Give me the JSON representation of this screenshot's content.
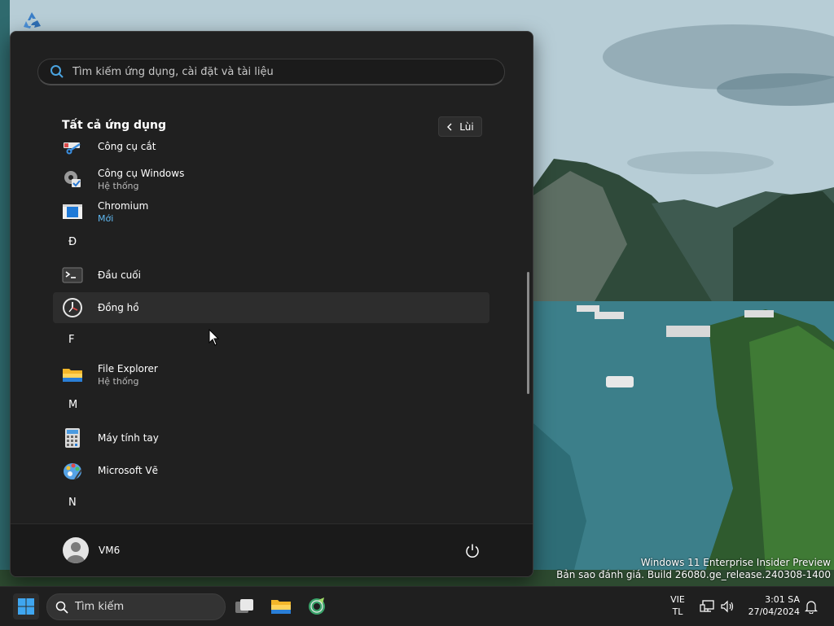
{
  "desktop": {
    "recycle_bin_icon": "recycle-bin-icon",
    "watermark_line1": "Windows 11 Enterprise Insider Preview",
    "watermark_line2": "Bản sao đánh giá. Build 26080.ge_release.240308-1400"
  },
  "start_menu": {
    "search_placeholder": "Tìm kiếm ứng dụng, cài đặt và tài liệu",
    "section_title": "Tất cả ứng dụng",
    "back_label": "Lùi",
    "apps": [
      {
        "name": "Công cụ cắt",
        "sub": "",
        "icon": "snipping-tool-icon"
      },
      {
        "name": "Công cụ Windows",
        "sub": "Hệ thống",
        "icon": "windows-tools-icon"
      },
      {
        "name": "Chromium",
        "sub": "Mới",
        "icon": "chromium-icon"
      },
      {
        "letter": "Đ"
      },
      {
        "name": "Đầu cuối",
        "sub": "",
        "icon": "terminal-icon"
      },
      {
        "name": "Đồng hồ",
        "sub": "",
        "icon": "clock-icon"
      },
      {
        "letter": "F"
      },
      {
        "name": "File Explorer",
        "sub": "Hệ thống",
        "icon": "folder-icon"
      },
      {
        "letter": "M"
      },
      {
        "name": "Máy tính tay",
        "sub": "",
        "icon": "calculator-icon"
      },
      {
        "name": "Microsoft Vẽ",
        "sub": "",
        "icon": "paint-icon"
      },
      {
        "letter": "N"
      }
    ],
    "user_name": "VM6"
  },
  "taskbar": {
    "search_label": "Tìm kiếm",
    "lang_line1": "VIE",
    "lang_line2": "TL",
    "time": "3:01 SA",
    "date": "27/04/2024"
  }
}
